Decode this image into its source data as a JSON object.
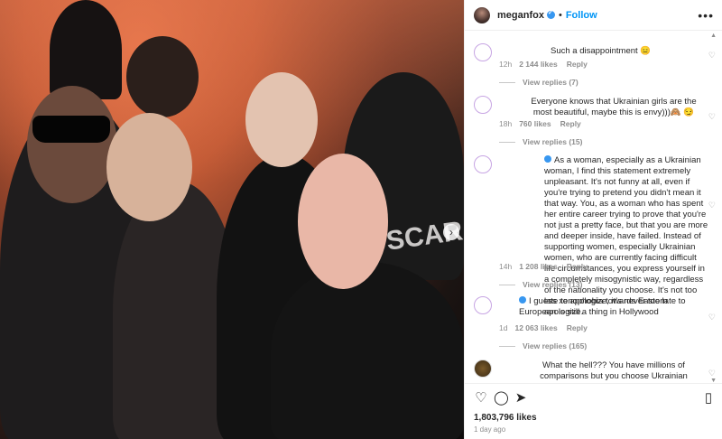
{
  "post": {
    "username": "meganfox",
    "follow_label": "Follow",
    "likes": "1,803,796 likes",
    "date": "1 day ago",
    "photo_text": "SCAR"
  },
  "comments": [
    {
      "text": "Such a disappointment 😑",
      "time": "12h",
      "likes": "2 144 likes",
      "reply": "Reply",
      "replies": "View replies (7)"
    },
    {
      "text": "Everyone knows that Ukrainian girls are the most beautiful, maybe this is envy)))🙈 😏",
      "time": "18h",
      "likes": "760 likes",
      "reply": "Reply",
      "replies": "View replies (15)"
    },
    {
      "text": "As a woman, especially as a Ukrainian woman, I find this statement extremely unpleasant. It's not funny at all, even if you're trying to pretend you didn't mean it that way. You, as a woman who has spent her entire career trying to prove that you're not just a pretty face, but that you are more and deeper inside, have failed. Instead of supporting women, especially Ukrainian women, who are currently facing difficult life circumstances, you express yourself in a completely misogynistic way, regardless of the nationality you choose. It's not too late to apologize, it's never too late to apologize.",
      "time": "14h",
      "likes": "1 208 likes",
      "reply": "Reply",
      "replies": "View replies (13)"
    },
    {
      "text": "I guess xenophobia towards Eastern European is still a thing in Hollywood",
      "time": "1d",
      "likes": "12 063 likes",
      "reply": "Reply",
      "replies": "View replies (165)"
    },
    {
      "text": "What the hell??? You have millions of comparisons but you choose Ukrainian women..",
      "time": "",
      "likes": "",
      "reply": "",
      "replies": ""
    }
  ],
  "icons": {
    "more": "more-options-icon",
    "heart": "heart-icon",
    "comment": "comment-icon",
    "share": "share-icon",
    "save": "bookmark-icon",
    "next": "chevron-right-icon"
  },
  "colors": {
    "link": "#0095f6",
    "verified": "#3897f0",
    "muted": "#8e8e8e"
  }
}
